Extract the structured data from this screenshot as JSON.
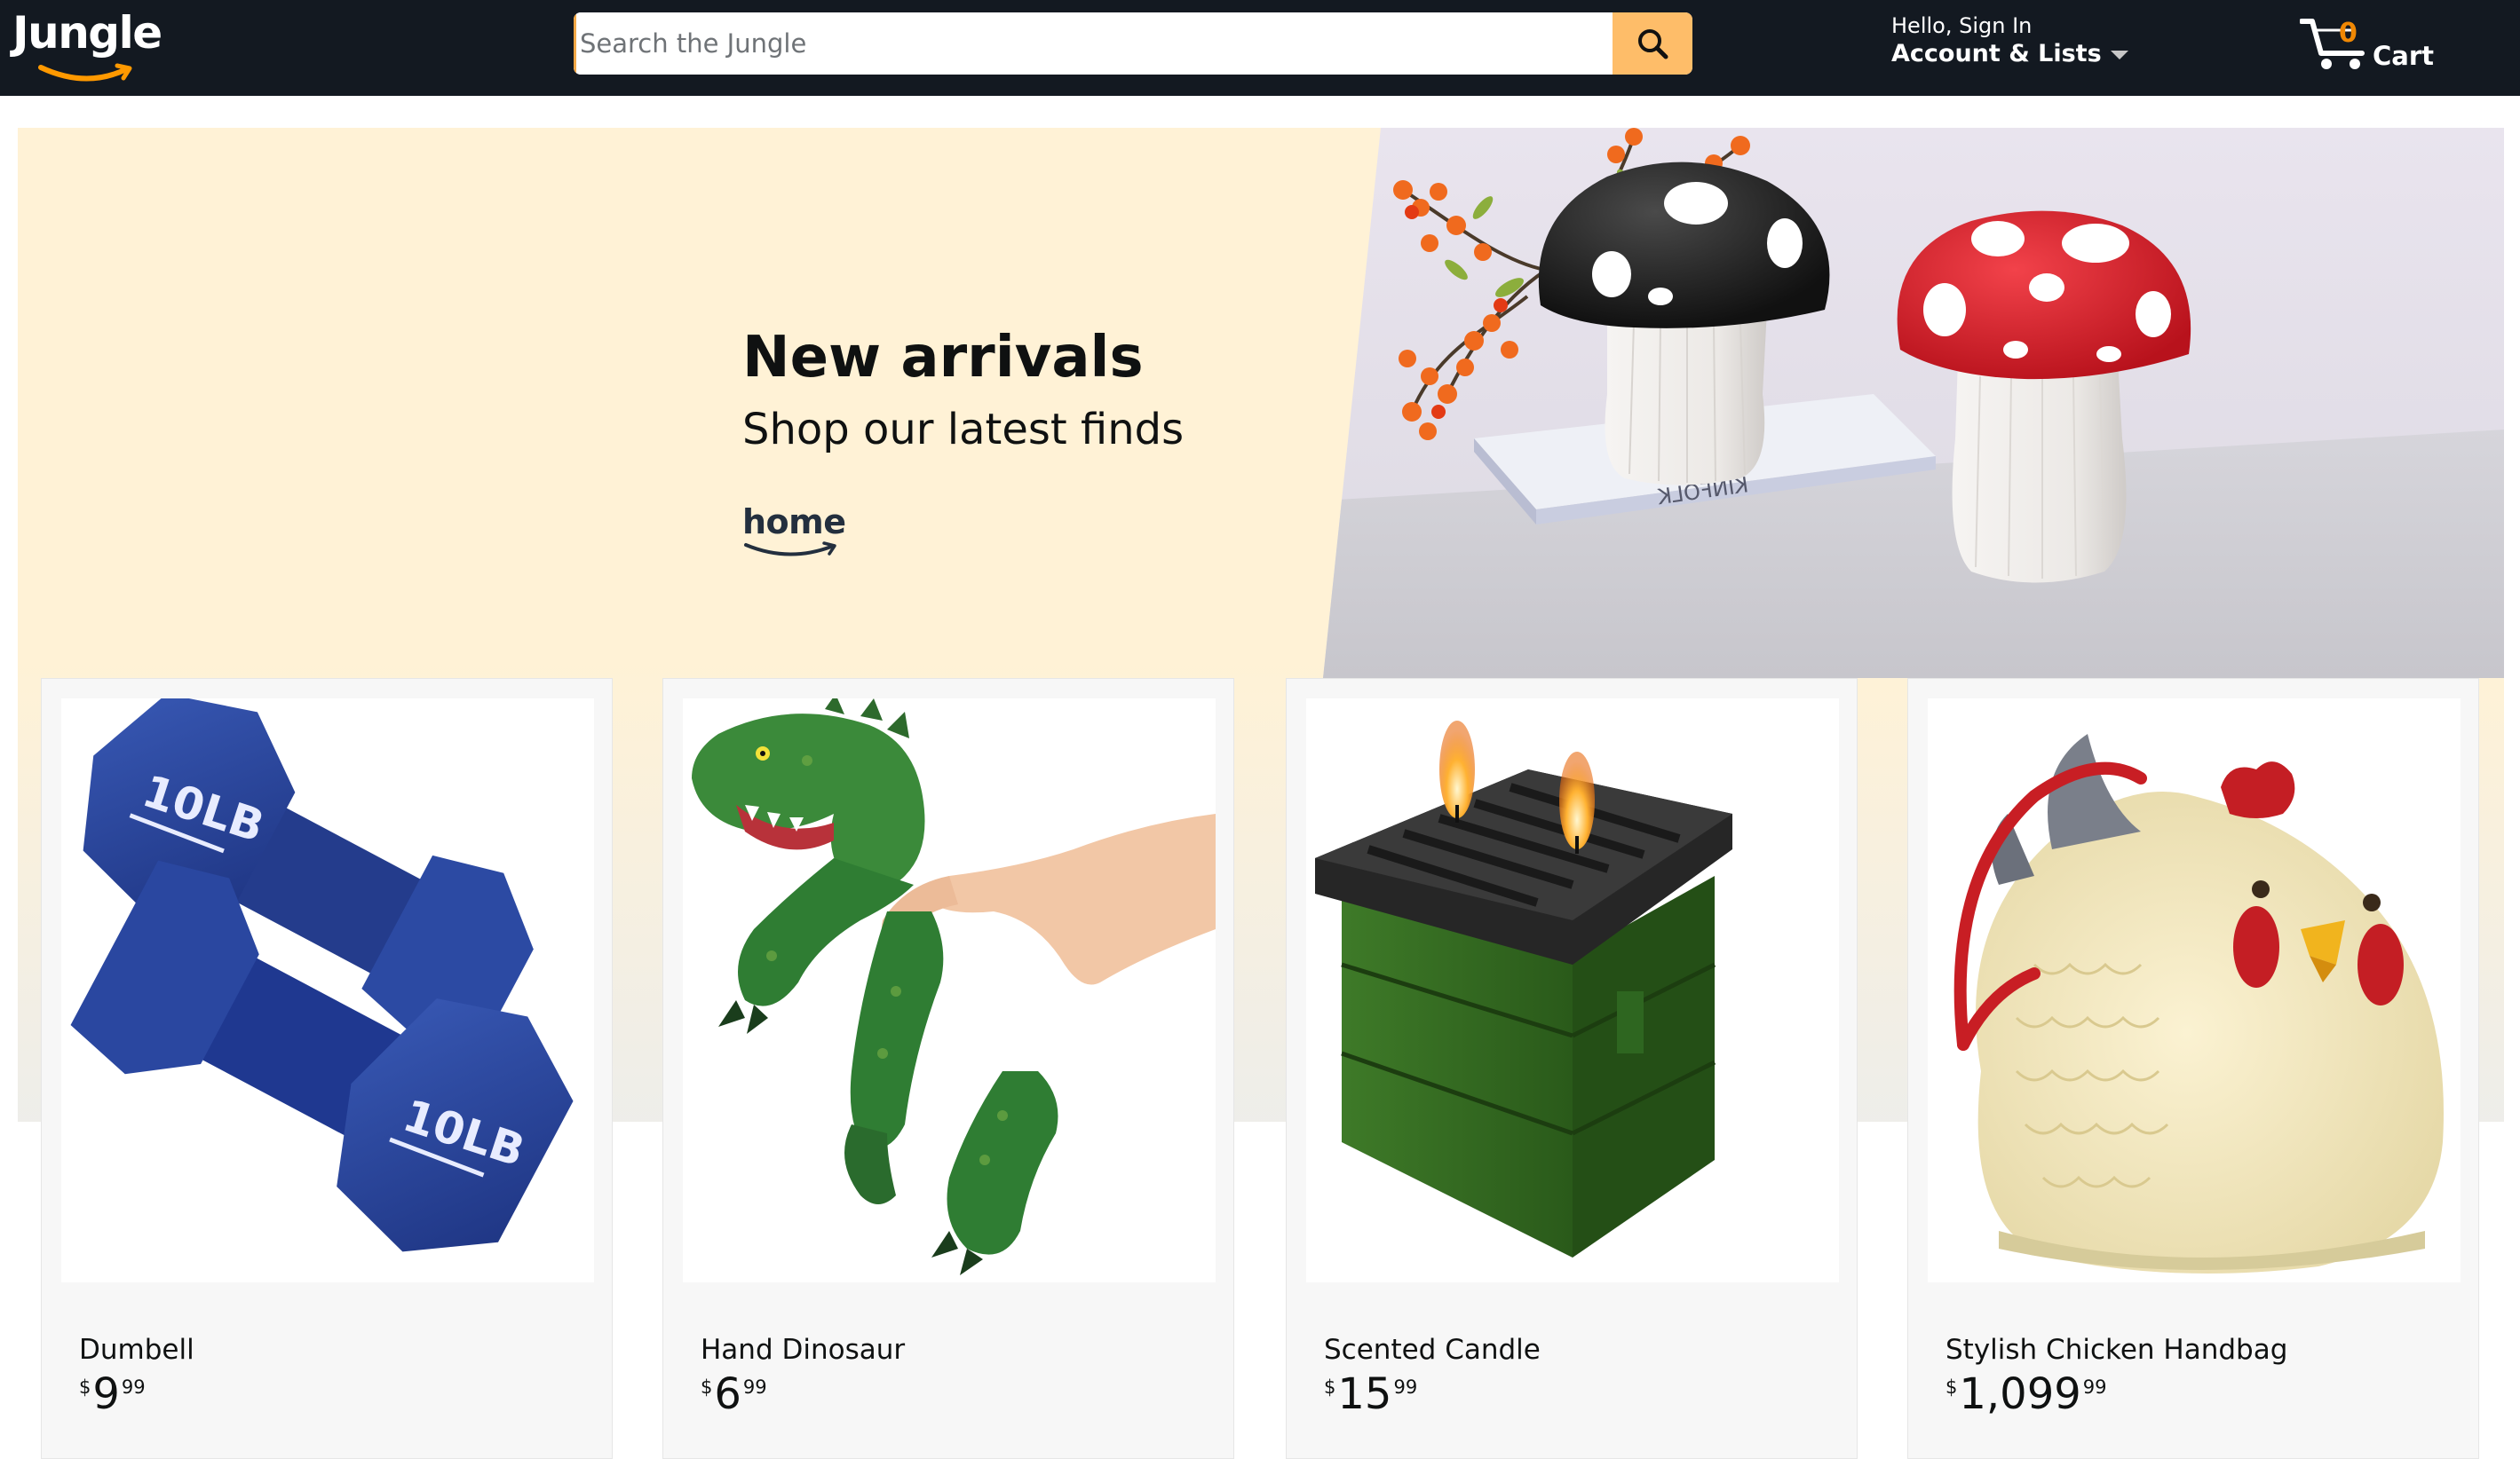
{
  "nav": {
    "logo": "Jungle",
    "search_placeholder": "Search the Jungle",
    "account_greeting": "Hello, Sign In",
    "account_label": "Account & Lists",
    "cart_count": "0",
    "cart_label": "Cart"
  },
  "hero": {
    "title": "New arrivals",
    "subtitle": "Shop our latest finds",
    "brand": "home",
    "book_label": "KINFOLK"
  },
  "products": [
    {
      "name": "Dumbell",
      "currency": "$",
      "whole": "9",
      "fraction": "99",
      "badge": "10LB"
    },
    {
      "name": "Hand Dinosaur",
      "currency": "$",
      "whole": "6",
      "fraction": "99"
    },
    {
      "name": "Scented Candle",
      "currency": "$",
      "whole": "15",
      "fraction": "99"
    },
    {
      "name": "Stylish Chicken Handbag",
      "currency": "$",
      "whole": "1,099",
      "fraction": "99"
    }
  ],
  "colors": {
    "nav_bg": "#131921",
    "search_button": "#febd69",
    "cart_count": "#f08804",
    "hero_bg": "#fff2d6"
  }
}
